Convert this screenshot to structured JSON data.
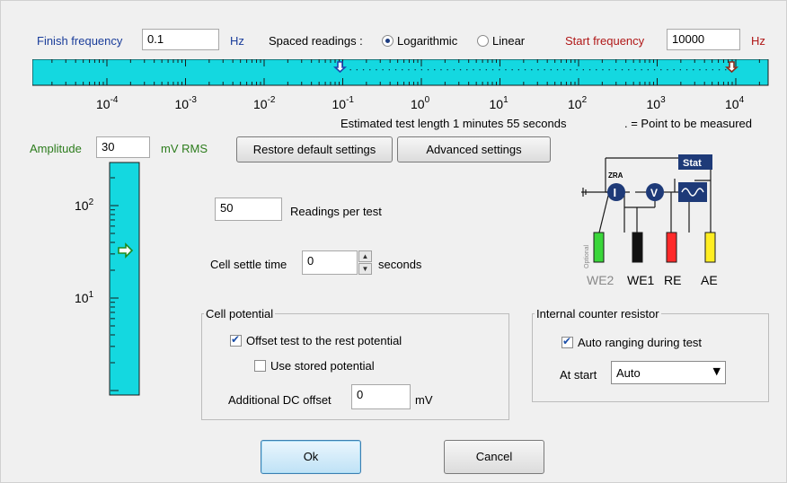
{
  "colors": {
    "accent_blue": "#1a3d9a",
    "start_red": "#b01818",
    "amplitude_green": "#2c7c1c",
    "scale_cyan": "#14d8e0"
  },
  "frequency": {
    "finish_label": "Finish frequency",
    "finish_value": "0.1",
    "finish_unit": "Hz",
    "spaced_label": "Spaced readings :",
    "spacing_options": [
      {
        "label": "Logarithmic",
        "selected": true
      },
      {
        "label": "Linear",
        "selected": false
      }
    ],
    "start_label": "Start frequency",
    "start_value": "10000",
    "start_unit": "Hz",
    "tick_mantissa": "10",
    "tick_exponents": [
      "-4",
      "-3",
      "-2",
      "-1",
      "0",
      "1",
      "2",
      "3",
      "4"
    ],
    "estimate_text": "Estimated test length 1 minutes  55 seconds",
    "legend_text": ". = Point to be measured"
  },
  "amplitude": {
    "label": "Amplitude",
    "value": "30",
    "unit": "mV RMS",
    "tick_mantissa": "10",
    "tick_exponents": [
      "2",
      "1"
    ]
  },
  "buttons": {
    "restore": "Restore default settings",
    "advanced": "Advanced settings",
    "ok": "Ok",
    "cancel": "Cancel"
  },
  "readings": {
    "value": "50",
    "label": "Readings per test"
  },
  "settle": {
    "label": "Cell settle time",
    "value": "0",
    "unit": "seconds"
  },
  "cell_potential": {
    "title": "Cell potential",
    "offset_label": "Offset test to the rest potential",
    "offset_checked": true,
    "stored_label": "Use stored potential",
    "stored_checked": false,
    "dc_label": "Additional DC offset",
    "dc_value": "0",
    "dc_unit": "mV"
  },
  "resistor": {
    "title": "Internal counter resistor",
    "auto_label": "Auto ranging during test",
    "auto_checked": true,
    "start_label": "At start",
    "start_value": "Auto"
  },
  "diagram": {
    "stat": "Stat",
    "zra": "ZRA",
    "current": "I",
    "voltage": "V",
    "optional": "Optional",
    "electrodes": [
      "WE2",
      "WE1",
      "RE",
      "AE"
    ]
  }
}
